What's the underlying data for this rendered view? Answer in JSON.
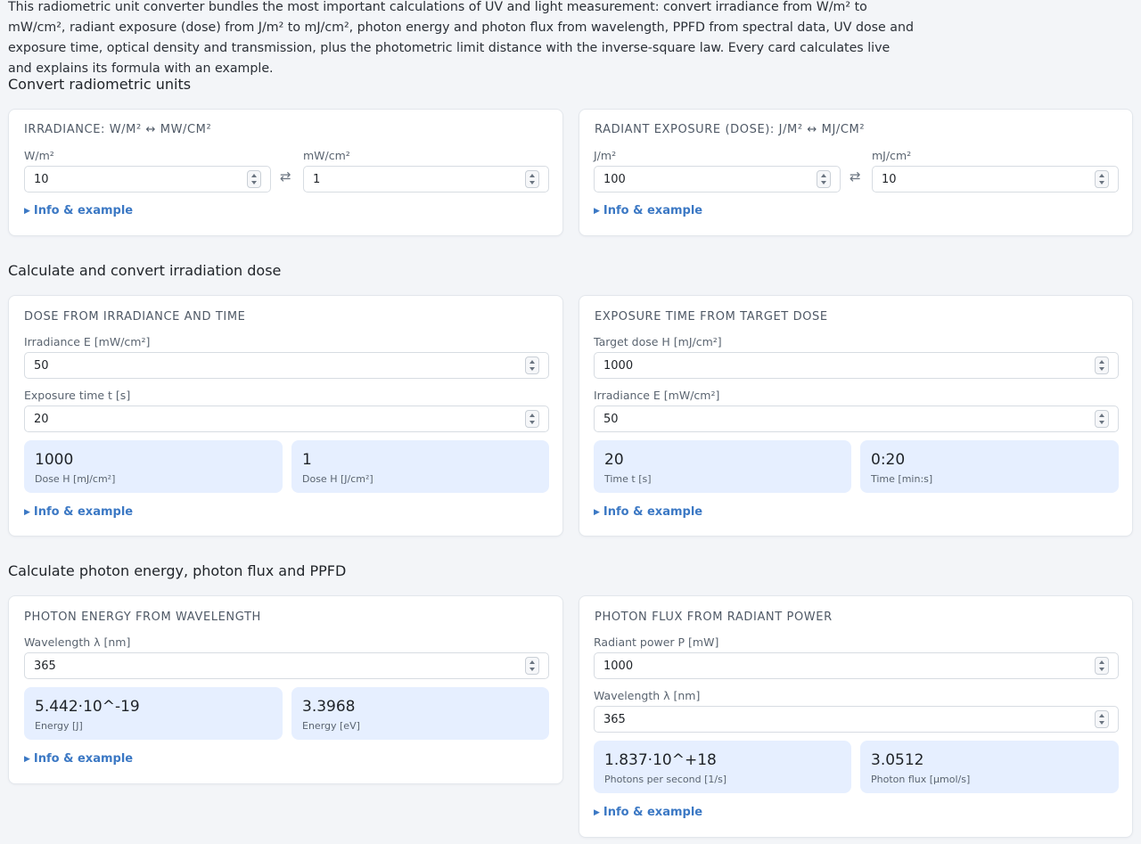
{
  "intro": "This radiometric unit converter bundles the most important calculations of UV and light measurement: convert irradiance from W/m² to mW/cm², radiant exposure (dose) from J/m² to mJ/cm², photon energy and photon flux from wavelength, PPFD from spectral data, UV dose and exposure time, optical density and transmission, plus the photometric limit distance with the inverse-square law. Every card calculates live and explains its formula with an example.",
  "sections": {
    "convert": "Convert radiometric units",
    "dose": "Calculate and convert irradiation dose",
    "photon": "Calculate photon energy, photon flux and PPFD"
  },
  "info_label": "Info & example",
  "icons": {
    "info": "triangle-right-icon",
    "spin": "spinner-arrows-icon",
    "swap": "swap-arrows-icon"
  },
  "cards": {
    "irradiance": {
      "title": "Irradiance: W/m² ↔ mW/cm²",
      "left_label": "W/m²",
      "left_value": "10",
      "right_label": "mW/cm²",
      "right_value": "1",
      "swap": "⇄"
    },
    "exposure": {
      "title": "Radiant exposure (dose): J/m² ↔ mJ/cm²",
      "left_label": "J/m²",
      "left_value": "100",
      "right_label": "mJ/cm²",
      "right_value": "10",
      "swap": "⇄"
    },
    "dose_from": {
      "title": "Dose from irradiance and time",
      "field1_label": "Irradiance E [mW/cm²]",
      "field1_value": "50",
      "field2_label": "Exposure time t [s]",
      "field2_value": "20",
      "result1_value": "1000",
      "result1_label": "Dose H [mJ/cm²]",
      "result2_value": "1",
      "result2_label": "Dose H [J/cm²]"
    },
    "exposure_time": {
      "title": "Exposure time from target dose",
      "field1_label": "Target dose H [mJ/cm²]",
      "field1_value": "1000",
      "field2_label": "Irradiance E [mW/cm²]",
      "field2_value": "50",
      "result1_value": "20",
      "result1_label": "Time t [s]",
      "result2_value": "0:20",
      "result2_label": "Time [min:s]"
    },
    "photon_energy": {
      "title": "Photon energy from wavelength",
      "field1_label": "Wavelength λ [nm]",
      "field1_value": "365",
      "result1_value": "5.442·10^-19",
      "result1_label": "Energy [J]",
      "result2_value": "3.3968",
      "result2_label": "Energy [eV]"
    },
    "photon_flux": {
      "title": "Photon flux from radiant power",
      "field1_label": "Radiant power P [mW]",
      "field1_value": "1000",
      "field2_label": "Wavelength λ [nm]",
      "field2_value": "365",
      "result1_value": "1.837·10^+18",
      "result1_label": "Photons per second [1/s]",
      "result2_value": "3.0512",
      "result2_label": "Photon flux [µmol/s]"
    }
  }
}
